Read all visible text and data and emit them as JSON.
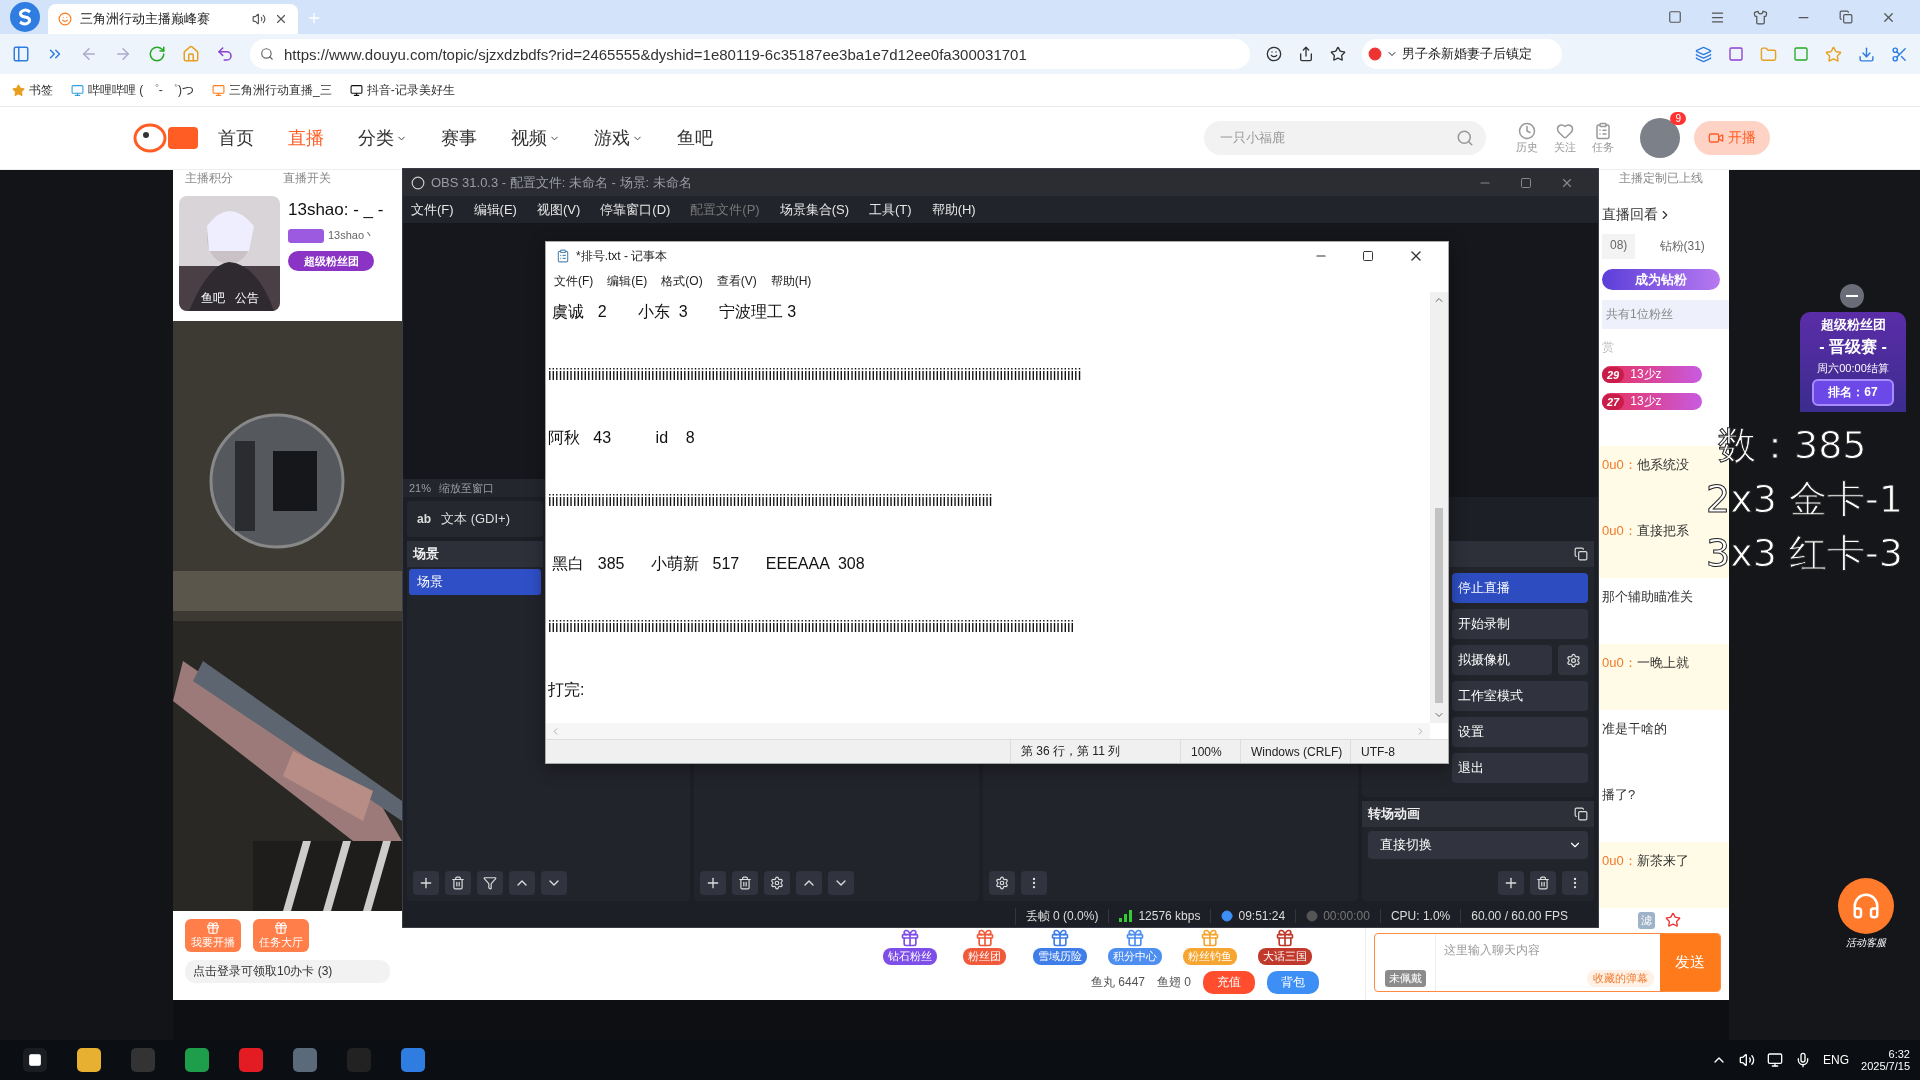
{
  "browser": {
    "tab": {
      "title": "三角洲行动主播巅峰赛"
    },
    "url": "https://www.douyu.com/topic/sjzxdzbdfs?rid=2465555&dyshid=1e80119-6c35187ee3ba1e7d12ee0fa300031701",
    "search_value": "男子杀新婚妻子后镇定",
    "bookmarks": [
      "书签",
      "哔哩哔哩 ( ゜- ゜)つ",
      "三角洲行动直播_三",
      "抖音-记录美好生"
    ]
  },
  "site_header": {
    "nav": [
      {
        "label": "首页",
        "selected": false,
        "dropdown": false
      },
      {
        "label": "直播",
        "selected": true,
        "dropdown": false
      },
      {
        "label": "分类",
        "selected": false,
        "dropdown": true
      },
      {
        "label": "赛事",
        "selected": false,
        "dropdown": false
      },
      {
        "label": "视频",
        "selected": false,
        "dropdown": true
      },
      {
        "label": "游戏",
        "selected": false,
        "dropdown": true
      },
      {
        "label": "鱼吧",
        "selected": false,
        "dropdown": false
      }
    ],
    "search": {
      "placeholder": "一只小福鹿"
    },
    "actions": [
      "历史",
      "关注",
      "任务"
    ],
    "avatar_badge": "9",
    "live_button": "开播"
  },
  "page_top": {
    "links": [
      "主播积分",
      "直播开关"
    ],
    "right_note": "主播定制已上线"
  },
  "streamer": {
    "avatar_tags": [
      "鱼吧",
      "公告"
    ],
    "name": "13shao: - _ -",
    "handle": "13shao丶",
    "fan_club": "超级粉丝团"
  },
  "page_bottom": {
    "left_actions": [
      "我要开播",
      "任务大厅"
    ],
    "login_tip": "点击登录可领取10办卡 (3)",
    "gifts": [
      "钻石粉丝",
      "粉丝团",
      "雪域历险",
      "积分中心",
      "粉丝钓鱼",
      "大话三国"
    ],
    "balances": [
      "鱼丸 6447",
      "鱼翅 0"
    ],
    "buttons": [
      "充值",
      "背包"
    ]
  },
  "chat": {
    "replay_link": "直播回看",
    "tabs": [
      {
        "label": "08)",
        "selected": false
      },
      {
        "label": "钻粉(31)",
        "selected": true
      }
    ],
    "banner": "成为钻粉",
    "fan_count": "共有1位粉丝",
    "section_label": "赏",
    "ranks": [
      {
        "rank": "29",
        "name": "13少z"
      },
      {
        "rank": "27",
        "name": "13少z"
      }
    ],
    "messages": [
      {
        "user": "0u0：",
        "text": "他系统没",
        "highlight": true
      },
      {
        "user": "0u0：",
        "text": "直接把系",
        "highlight": true
      },
      {
        "text": "那个辅助瞄准关",
        "highlight": false
      },
      {
        "user": "0u0：",
        "text": "一晚上就",
        "highlight": true
      },
      {
        "text": "准是干啥的",
        "highlight": false
      },
      {
        "text": "播了?",
        "highlight": false
      },
      {
        "user": "0u0：",
        "text": "新茶来了",
        "highlight": true
      }
    ],
    "filter_label": "滤",
    "input": {
      "badge": "未佩戴",
      "placeholder": "这里输入聊天内容",
      "saved": "收藏的弹幕",
      "send": "发送"
    }
  },
  "fan_club_badge": {
    "title": "超级粉丝团",
    "event": "- 晋级赛 -",
    "settle": "周六00:00结算",
    "rank": "排名：67"
  },
  "support": {
    "label": "活动客服"
  },
  "overlay_lines": [
    "数：385",
    "2x3 金卡-1",
    "3x3 红卡-3"
  ],
  "obs": {
    "title": "OBS 31.0.3 - 配置文件: 未命名 - 场景: 未命名",
    "menu": [
      {
        "label": "文件(F)",
        "disabled": false
      },
      {
        "label": "编辑(E)",
        "disabled": false
      },
      {
        "label": "视图(V)",
        "disabled": false
      },
      {
        "label": "停靠窗口(D)",
        "disabled": false
      },
      {
        "label": "配置文件(P)",
        "disabled": true
      },
      {
        "label": "场景集合(S)",
        "disabled": false
      },
      {
        "label": "工具(T)",
        "disabled": false
      },
      {
        "label": "帮助(H)",
        "disabled": false
      }
    ],
    "zoom": "21%",
    "zoom_mode": "缩放至窗口",
    "source_icon": "ab",
    "source_type": "文本 (GDI+)",
    "scenes": {
      "title": "场景",
      "items": [
        {
          "label": "场景",
          "selected": true
        }
      ]
    },
    "controls": [
      {
        "label": "停止直播",
        "active": true,
        "kind": "plain"
      },
      {
        "label": "开始录制",
        "active": false,
        "kind": "plain"
      },
      {
        "label": "拟摄像机",
        "active": false,
        "kind": "with_settings"
      },
      {
        "label": "工作室模式",
        "active": false,
        "kind": "plain"
      },
      {
        "label": "设置",
        "active": false,
        "kind": "plain"
      },
      {
        "label": "退出",
        "active": false,
        "kind": "plain"
      }
    ],
    "transition": {
      "title": "转场动画",
      "value": "直接切换"
    },
    "status": {
      "dropped": "丢帧 0 (0.0%)",
      "bitrate": "12576 kbps",
      "stream_time": "09:51:24",
      "record_time": "00:00:00",
      "cpu": "CPU: 1.0%",
      "fps": "60.00 / 60.00 FPS"
    }
  },
  "notepad": {
    "title": "*排号.txt - 记事本",
    "menu": [
      "文件(F)",
      "编辑(E)",
      "格式(O)",
      "查看(V)",
      "帮助(H)"
    ],
    "lines": [
      " 虞诚   2       小东  3       宁波理工 3",
      "iiiiiiiiiiiiiiiiiiiiiiiiiiiiiiiiiiiiiiiiiiiiiiiiiiiiiiiiiiiiiiiiiiiiiiiiiiiiiiiiiiiiiiiiiiiiiiiiiiiiiiiiiiiiiiiiiiiiiiiiiiiiiiiiiiiiiiiiiiiiiiiiiiiiii",
      "阿秋   43          id    8",
      "iiiiiiiiiiiiiiiiiiiiiiiiiiiiiiiiiiiiiiiiiiiiiiiiiiiiiiiiiiiiiiiiiiiiiiiiiiiiiiiiiiiiiiiiiiiiiiiiiiiiiiiiiiiiiiiiiiiiiiiiiiiii",
      " 黑白   385      小萌新   517      EEEAAA  308",
      "iiiiiiiiiiiiiiiiiiiiiiiiiiiiiiiiiiiiiiiiiiiiiiiiiiiiiiiiiiiiiiiiiiiiiiiiiiiiiiiiiiiiiiiiiiiiiiiiiiiiiiiiiiiiiiiiiiiiiiiiiiiiiiiiiiiiiiiiiiiiiiiiiiii",
      "打完:"
    ],
    "status": [
      "第 36 行，第 11 列",
      "100%",
      "Windows (CRLF)",
      "UTF-8"
    ]
  },
  "taskbar": {
    "lang": "ENG",
    "time": "6:32",
    "date": "2025/7/15"
  }
}
